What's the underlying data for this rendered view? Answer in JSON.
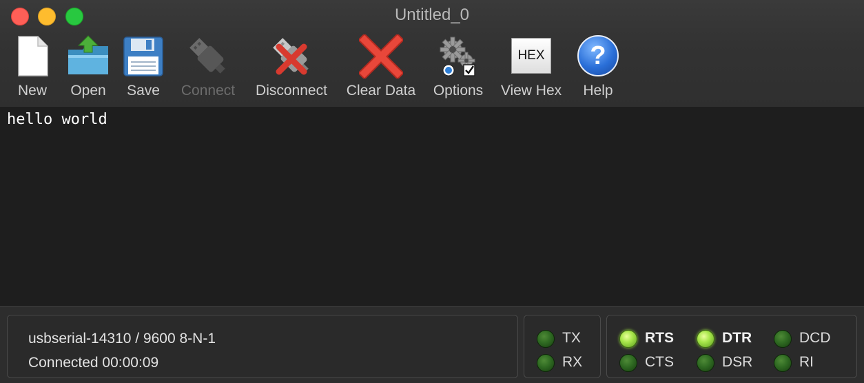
{
  "window": {
    "title": "Untitled_0"
  },
  "toolbar": {
    "new_label": "New",
    "open_label": "Open",
    "save_label": "Save",
    "connect_label": "Connect",
    "disconnect_label": "Disconnect",
    "clear_label": "Clear Data",
    "options_label": "Options",
    "viewhex_label": "View Hex",
    "viewhex_icon_text": "HEX",
    "help_label": "Help",
    "help_icon_text": "?"
  },
  "terminal": {
    "text": "hello world"
  },
  "status": {
    "port_line": "usbserial-14310 / 9600 8-N-1",
    "connection_line": "Connected 00:00:09"
  },
  "leds": {
    "tx": {
      "label": "TX",
      "on": false
    },
    "rx": {
      "label": "RX",
      "on": false
    },
    "rts": {
      "label": "RTS",
      "on": true
    },
    "dtr": {
      "label": "DTR",
      "on": true
    },
    "dcd": {
      "label": "DCD",
      "on": false
    },
    "cts": {
      "label": "CTS",
      "on": false
    },
    "dsr": {
      "label": "DSR",
      "on": false
    },
    "ri": {
      "label": "RI",
      "on": false
    }
  },
  "colors": {
    "led_on": "#a7e64a",
    "led_off": "#2f6a22",
    "close": "#fe5f57",
    "minimize": "#febc2e",
    "maximize": "#28c840"
  }
}
